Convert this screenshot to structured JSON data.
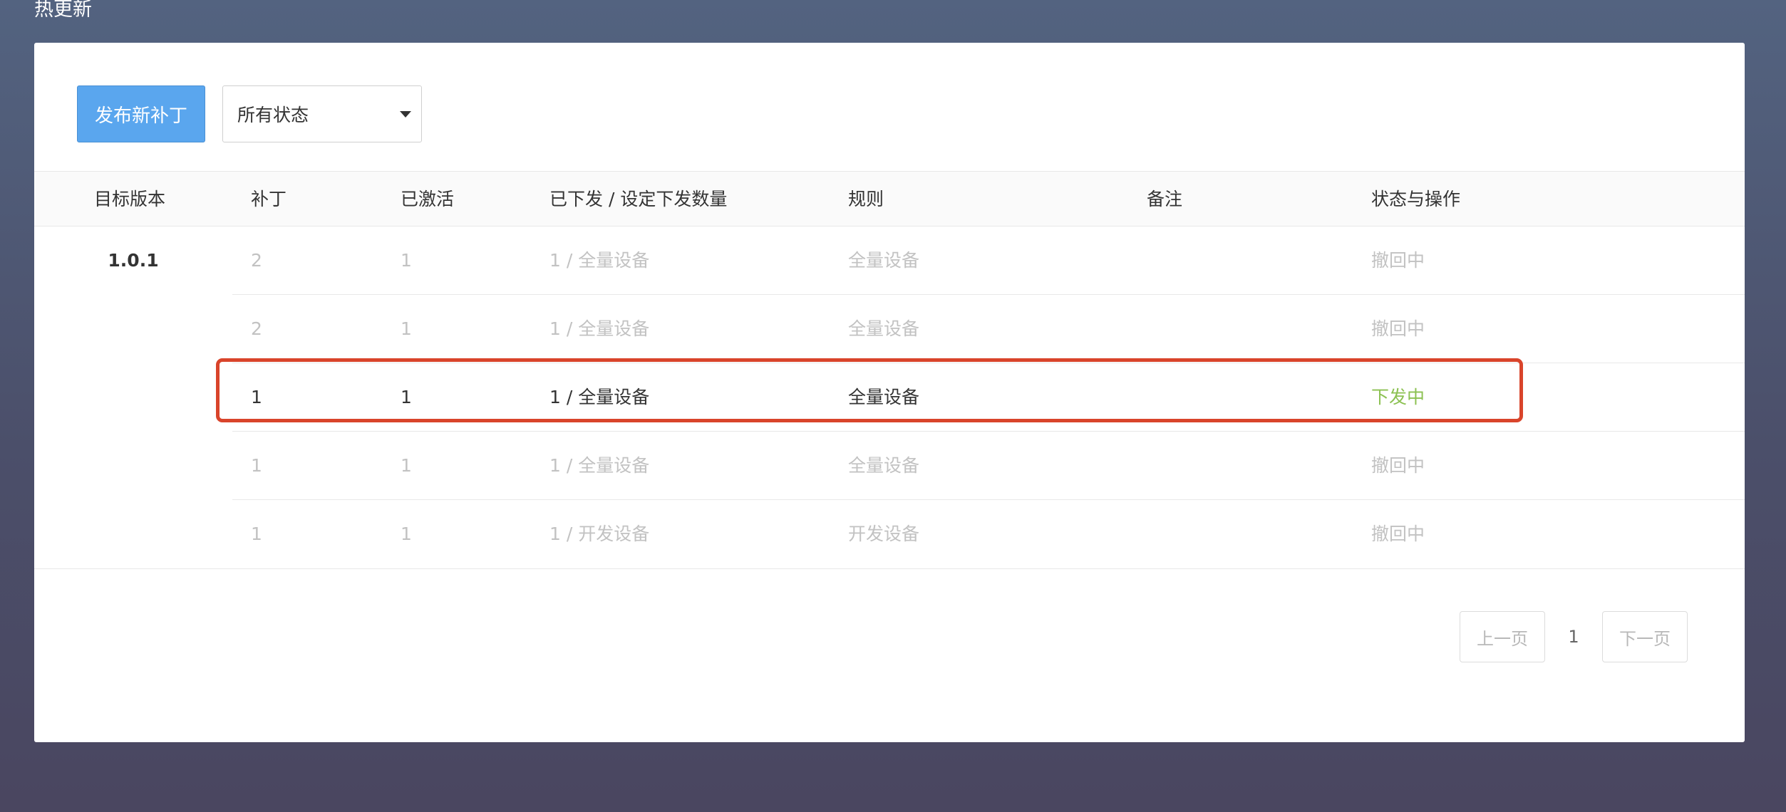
{
  "page": {
    "title": "热更新"
  },
  "toolbar": {
    "publish_label": "发布新补丁",
    "status_filter": {
      "selected": "所有状态"
    }
  },
  "table": {
    "columns": [
      "目标版本",
      "补丁",
      "已激活",
      "已下发 / 设定下发数量",
      "规则",
      "备注",
      "状态与操作"
    ],
    "version": "1.0.1",
    "rows": [
      {
        "patch": "2",
        "activated": "1",
        "issued": "1 / 全量设备",
        "rule": "全量设备",
        "note": "",
        "status": "撤回中"
      },
      {
        "patch": "2",
        "activated": "1",
        "issued": "1 / 全量设备",
        "rule": "全量设备",
        "note": "",
        "status": "撤回中"
      },
      {
        "patch": "1",
        "activated": "1",
        "issued": "1 / 全量设备",
        "rule": "全量设备",
        "note": "",
        "status": "下发中"
      },
      {
        "patch": "1",
        "activated": "1",
        "issued": "1 / 全量设备",
        "rule": "全量设备",
        "note": "",
        "status": "撤回中"
      },
      {
        "patch": "1",
        "activated": "1",
        "issued": "1 / 开发设备",
        "rule": "开发设备",
        "note": "",
        "status": "撤回中"
      }
    ]
  },
  "pagination": {
    "prev_label": "上一页",
    "current_page": "1",
    "next_label": "下一页"
  },
  "colors": {
    "primary": "#5aa6ee",
    "active_status": "#8cc152",
    "highlight_border": "#d9442b",
    "muted_text": "#c2c2c2"
  }
}
